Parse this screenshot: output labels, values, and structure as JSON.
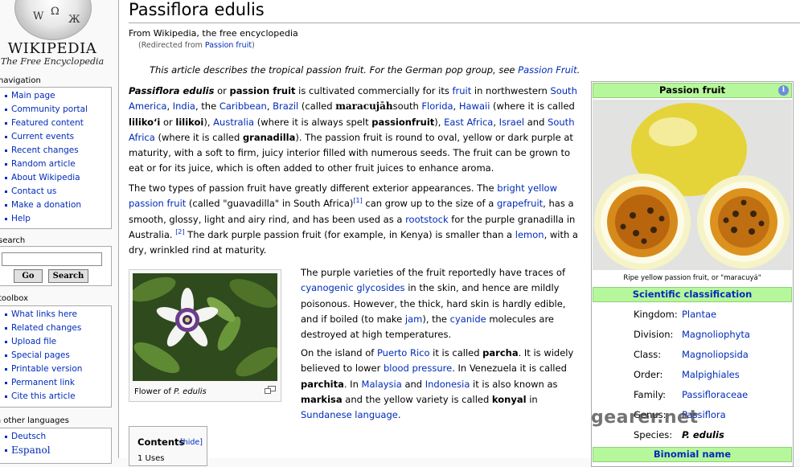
{
  "logo": {
    "wordmark": "WIKIPEDIA",
    "tagline": "The Free Encyclopedia"
  },
  "sidebar": {
    "navigation_title": "navigation",
    "navigation": [
      "Main page",
      "Community portal",
      "Featured content",
      "Current events",
      "Recent changes",
      "Random article",
      "About Wikipedia",
      "Contact us",
      "Make a donation",
      "Help"
    ],
    "search_title": "search",
    "search_value": "",
    "go_label": "Go",
    "search_label": "Search",
    "toolbox_title": "toolbox",
    "toolbox": [
      "What links here",
      "Related changes",
      "Upload file",
      "Special pages",
      "Printable version",
      "Permanent link",
      "Cite this article"
    ],
    "languages_title": "in other languages",
    "languages": [
      "Deutsch",
      "Espanol"
    ]
  },
  "article": {
    "title": "Passiflora edulis",
    "site_sub": "From Wikipedia, the free encyclopedia",
    "redirect_prefix": "(Redirected from ",
    "redirect_link": "Passion fruit",
    "redirect_suffix": ")",
    "dablink_text": "This article describes the tropical passion fruit. For the German pop group, see ",
    "dablink_link": "Passion Fruit",
    "dablink_end": ".",
    "p1": {
      "t1": "Passiflora edulis",
      "t2": " or ",
      "t3": "passion fruit",
      "t4": " is cultivated commercially for its ",
      "l1": "fruit",
      "t5": " in northwestern ",
      "l2": "South America",
      "t6": ", ",
      "l3": "India",
      "t7": ", the ",
      "l4": "Caribbean",
      "t8": ", ",
      "l5": "Brazil",
      "t9": " (called ",
      "t10": "maracujāh",
      "t11": "south ",
      "l6": "Florida",
      "t12": ", ",
      "l7": "Hawaii",
      "t13": " (where it is called ",
      "t14": "liliko‘i",
      "t15": " or ",
      "t16": "lilikoi",
      "t17": "), ",
      "l8": "Australia",
      "t18": " (where it is always spelt ",
      "t19": "passionfruit",
      "t20": "), ",
      "l9": "East Africa",
      "t21": ", ",
      "l10": "Israel",
      "t22": " and ",
      "l11": "South Africa",
      "t23": " (where it is called ",
      "t24": "granadilla",
      "t25": "). The passion fruit is round to oval, yellow or dark purple at maturity, with a soft to firm, juicy interior filled with numerous seeds. The fruit can be grown to eat or for its juice, which is often added to other fruit juices to enhance aroma."
    },
    "p2": {
      "t1": "The two types of passion fruit have greatly different exterior appearances. The ",
      "l1": "bright yellow passion fruit",
      "t2": " (called \"guavadilla\" in South Africa)",
      "r1": "[1]",
      "t3": " can grow up to the size of a ",
      "l2": "grapefruit",
      "t4": ", has a smooth, glossy, light and airy rind, and has been used as a ",
      "l3": "rootstock",
      "t5": " for the purple granadilla in Australia. ",
      "r2": "[2]",
      "t6": " The dark purple passion fruit (for example, in Kenya) is smaller than a ",
      "l4": "lemon",
      "t7": ", with a dry, wrinkled rind at maturity."
    },
    "p3": {
      "t1": "The purple varieties of the fruit reportedly have traces of ",
      "l1": "cyanogenic glycosides",
      "t2": " in the skin, and hence are mildly poisonous. However, the thick, hard skin is hardly edible, and if boiled (to make ",
      "l2": "jam",
      "t3": "), the ",
      "l3": "cyanide",
      "t4": " molecules are destroyed at high temperatures."
    },
    "p4": {
      "t1": "On the island of ",
      "l1": "Puerto Rico",
      "t2": " it is called ",
      "t3": "parcha",
      "t4": ". It is widely believed to lower ",
      "l2": "blood pressure",
      "t5": ". In Venezuela it is called ",
      "t6": "parchita",
      "t7": ". In ",
      "l3": "Malaysia",
      "t8": " and ",
      "l4": "Indonesia",
      "t9": " it is also known as ",
      "t10": "markisa",
      "t11": " and the yellow variety is called ",
      "t12": "konyal",
      "t13": " in ",
      "l5": "Sundanese language",
      "t14": "."
    },
    "thumb_caption_prefix": "Flower of ",
    "thumb_caption_italic": "P. edulis",
    "toc_title": "Contents",
    "toc_hide": "[hide]",
    "toc_first": "1   Uses"
  },
  "infobox": {
    "title": "Passion fruit",
    "info_icon": "i",
    "caption": "Ripe yellow passion fruit, or \"maracuyá\"",
    "sci_heading": "Scientific classification",
    "taxonomy": [
      {
        "rank": "Kingdom:",
        "value": "Plantae"
      },
      {
        "rank": "Division:",
        "value": "Magnoliophyta"
      },
      {
        "rank": "Class:",
        "value": "Magnoliopsida"
      },
      {
        "rank": "Order:",
        "value": "Malpighiales"
      },
      {
        "rank": "Family:",
        "value": "Passifloraceae"
      },
      {
        "rank": "Genus:",
        "value": "Passiflora"
      },
      {
        "rank": "Species:",
        "value": "P. edulis"
      }
    ],
    "binomial_heading": "Binomial name"
  },
  "watermark": "gearer.net",
  "colors": {
    "link": "#002bb8",
    "infobox_header": "#b7f79c",
    "page_background": "#f9f9f9"
  },
  "icons": [
    "wikipedia-globe-icon",
    "info-icon",
    "magnify-icon",
    "bullet-icon"
  ]
}
